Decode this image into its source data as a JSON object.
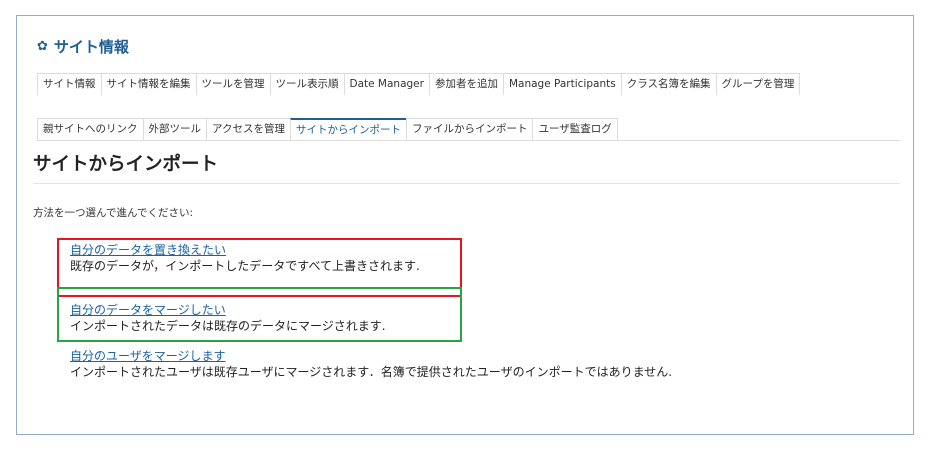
{
  "site": {
    "title": "サイト情報",
    "icon": "gear-icon"
  },
  "tabs_row1": [
    {
      "label": "サイト情報"
    },
    {
      "label": "サイト情報を編集"
    },
    {
      "label": "ツールを管理"
    },
    {
      "label": "ツール表示順"
    },
    {
      "label": "Date Manager"
    },
    {
      "label": "参加者を追加"
    },
    {
      "label": "Manage Participants"
    },
    {
      "label": "クラス名簿を編集"
    },
    {
      "label": "グループを管理"
    }
  ],
  "tabs_row2": [
    {
      "label": "親サイトへのリンク"
    },
    {
      "label": "外部ツール"
    },
    {
      "label": "アクセスを管理"
    },
    {
      "label": "サイトからインポート",
      "active": true
    },
    {
      "label": "ファイルからインポート"
    },
    {
      "label": "ユーザ監査ログ"
    }
  ],
  "main": {
    "heading": "サイトからインポート",
    "instruction": "方法を一つ選んで進んでください:",
    "options": [
      {
        "link": "自分のデータを置き換えたい",
        "description": "既存のデータが，インポートしたデータですべて上書きされます.",
        "highlight_color": "#e8141e"
      },
      {
        "link": "自分のデータをマージしたい",
        "description": "インポートされたデータは既存のデータにマージされます.",
        "highlight_color": "#2aa343"
      },
      {
        "link": "自分のユーザをマージします",
        "description": "インポートされたユーザは既存ユーザにマージされます．名簿で提供されたユーザのインポートではありません."
      }
    ]
  },
  "colors": {
    "accent": "#1f5f93",
    "link": "#1a62a3",
    "panel_border": "#93adc8"
  }
}
